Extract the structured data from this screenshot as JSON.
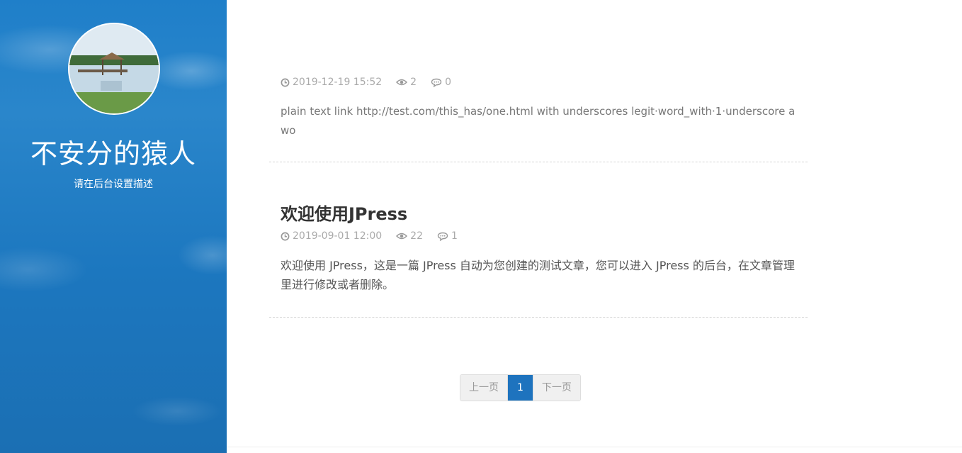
{
  "site": {
    "title": "不安分的猿人",
    "description": "请在后台设置描述"
  },
  "posts": [
    {
      "title": "",
      "date": "2019-12-19 15:52",
      "views": "2",
      "comments": "0",
      "excerpt": "plain text link http://test.com/this_has/one.html with underscores legit·word_with·1·underscore a wo"
    },
    {
      "title": "欢迎使用JPress",
      "date": "2019-09-01 12:00",
      "views": "22",
      "comments": "1",
      "excerpt": "欢迎使用 JPress，这是一篇 JPress 自动为您创建的测试文章，您可以进入 JPress 的后台，在文章管理里进行修改或者删除。"
    }
  ],
  "pagination": {
    "prev": "上一页",
    "current": "1",
    "next": "下一页"
  },
  "colors": {
    "sidebar": "#1f7fc9",
    "accent": "#1e73be",
    "meta": "#aaaaaa"
  },
  "icons": {
    "date": "clock-icon",
    "views": "eye-icon",
    "comments": "comment-icon"
  }
}
